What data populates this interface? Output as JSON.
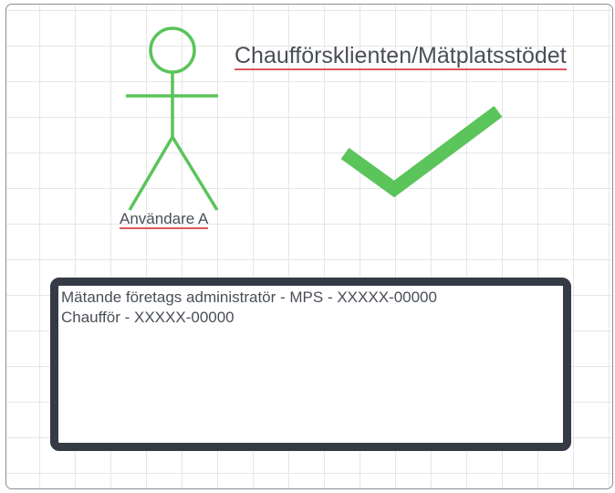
{
  "diagram": {
    "actor": {
      "label": "Användare A",
      "color": "#5bc45b"
    },
    "title": "Chaufförsklienten/Mätplatsstödet",
    "check_color": "#5bc45b",
    "roles_box": {
      "lines": [
        "Mätande företags administratör - MPS - XXXXX-00000",
        "Chaufför - XXXXX-00000"
      ],
      "border_color": "#353b45"
    },
    "spellcheck_underline_color": "#e0565b"
  }
}
